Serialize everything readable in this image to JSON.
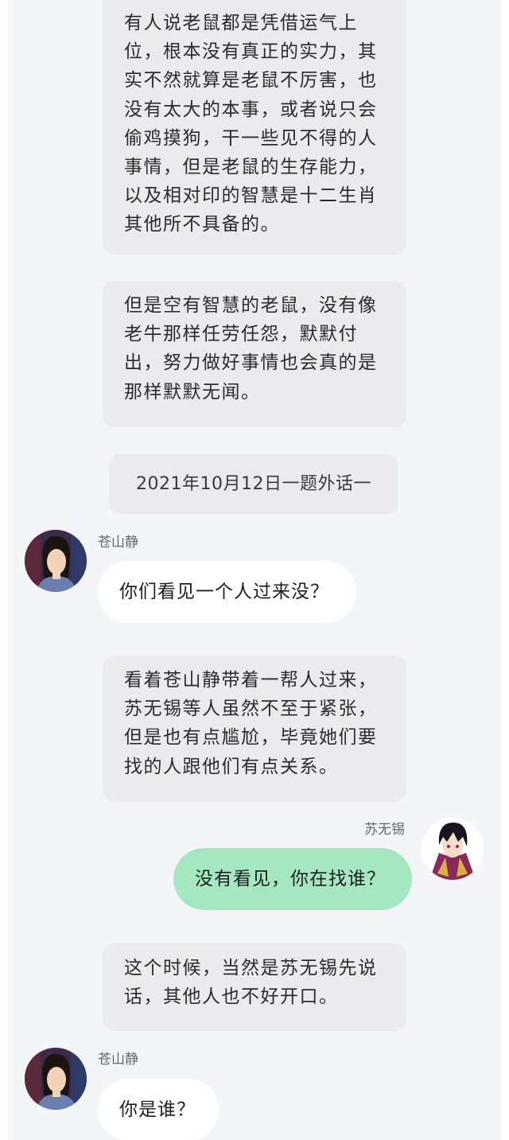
{
  "narrations": [
    "有人说老鼠都是凭借运气上\n位，根本没有真正的实力，其\n实不然就算是老鼠不厉害，也\n没有太大的本事，或者说只会\n偷鸡摸狗，干一些见不得的人\n事情，但是老鼠的生存能力，\n以及相对印的智慧是十二生肖\n其他所不具备的。",
    "但是空有智慧的老鼠，没有像\n老牛那样任劳任怨，默默付\n出，努力做好事情也会真的是\n那样默默无闻。",
    "看着苍山静带着一帮人过来，\n苏无锡等人虽然不至于紧张，\n但是也有点尴尬，毕竟她们要\n找的人跟他们有点关系。",
    "这个时候，当然是苏无锡先说\n话，其他人也不好开口。"
  ],
  "date_divider": "2021年10月12日一题外话一",
  "messages": [
    {
      "speaker": "苍山静",
      "text": "你们看见一个人过来没？"
    },
    {
      "speaker": "苏无锡",
      "text": "没有看见，你在找谁？"
    },
    {
      "speaker": "苍山静",
      "text": "你是谁？"
    }
  ]
}
